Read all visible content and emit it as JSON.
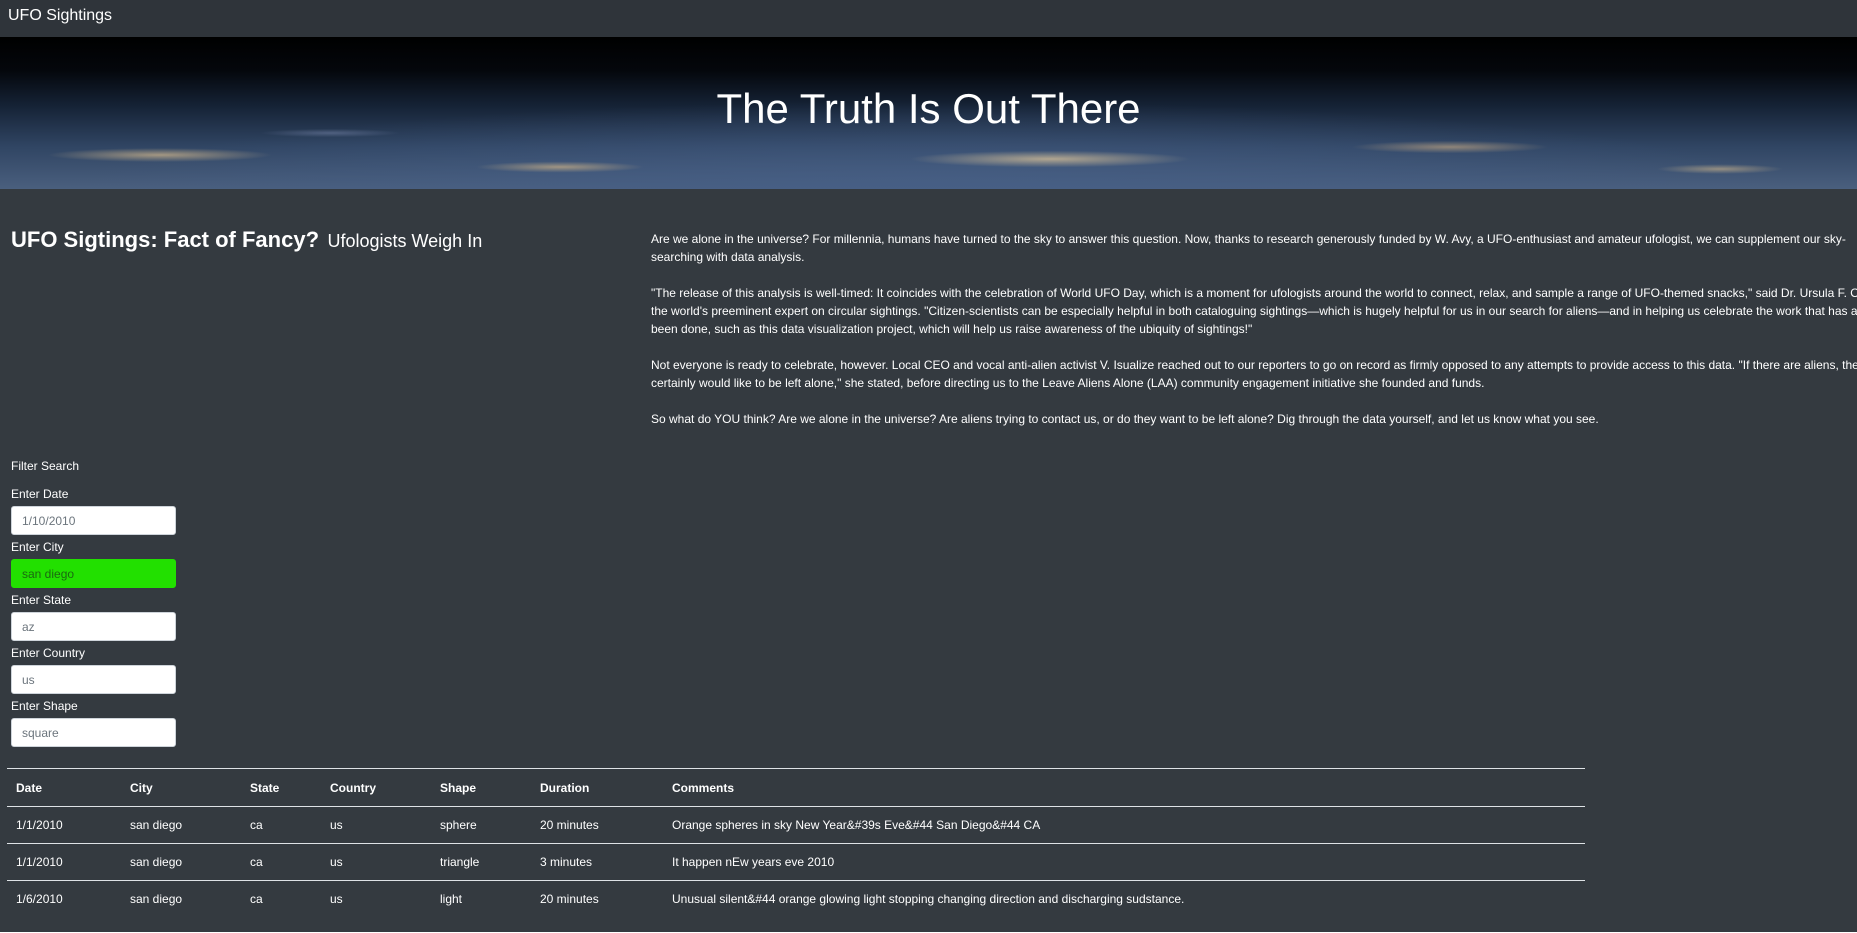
{
  "navbar": {
    "brand": "UFO Sightings"
  },
  "hero": {
    "title": "The Truth Is Out There"
  },
  "article": {
    "headline": "UFO Sigtings: Fact of Fancy?",
    "subheadline": "Ufologists Weigh In",
    "paragraphs": [
      "Are we alone in the universe? For millennia, humans have turned to the sky to answer this question. Now, thanks to research generously funded by W. Avy, a UFO-enthusiast and amateur ufologist, we can supplement our sky-searching with data analysis.",
      "\"The release of this analysis is well-timed: It coincides with the celebration of World UFO Day, which is a moment for ufologists around the world to connect, relax, and sample a range of UFO-themed snacks,\" said Dr. Ursula F. Olivia, the world's preeminent expert on circular sightings. \"Citizen-scientists can be especially helpful in both cataloguing sightings—which is hugely helpful for us in our search for aliens—and in helping us celebrate the work that has already been done, such as this data visualization project, which will help us raise awareness of the ubiquity of sightings!\"",
      "Not everyone is ready to celebrate, however. Local CEO and vocal anti-alien activist V. Isualize reached out to our reporters to go on record as firmly opposed to any attempts to provide access to this data. \"If there are aliens, they certainly would like to be left alone,\" she stated, before directing us to the Leave Aliens Alone (LAA) community engagement initiative she founded and funds.",
      "So what do YOU think? Are we alone in the universe? Are aliens trying to contact us, or do they want to be left alone? Dig through the data yourself, and let us know what you see."
    ]
  },
  "filters": {
    "heading": "Filter Search",
    "date": {
      "label": "Enter Date",
      "placeholder": "1/10/2010"
    },
    "city": {
      "label": "Enter City",
      "placeholder": "san diego"
    },
    "state": {
      "label": "Enter State",
      "placeholder": "az"
    },
    "country": {
      "label": "Enter Country",
      "placeholder": "us"
    },
    "shape": {
      "label": "Enter Shape",
      "placeholder": "square"
    },
    "active_color": "#22e000"
  },
  "table": {
    "columns": [
      "Date",
      "City",
      "State",
      "Country",
      "Shape",
      "Duration",
      "Comments"
    ],
    "rows": [
      [
        "1/1/2010",
        "san diego",
        "ca",
        "us",
        "sphere",
        "20 minutes",
        "Orange spheres in sky New Year&#39s Eve&#44 San Diego&#44 CA"
      ],
      [
        "1/1/2010",
        "san diego",
        "ca",
        "us",
        "triangle",
        "3 minutes",
        "It happen nEw years eve 2010"
      ],
      [
        "1/6/2010",
        "san diego",
        "ca",
        "us",
        "light",
        "20 minutes",
        "Unusual silent&#44 orange glowing light stopping changing direction and discharging sudstance."
      ]
    ]
  },
  "colors": {
    "background": "#343a40",
    "navbar": "#2f343a",
    "text": "#ffffff"
  }
}
